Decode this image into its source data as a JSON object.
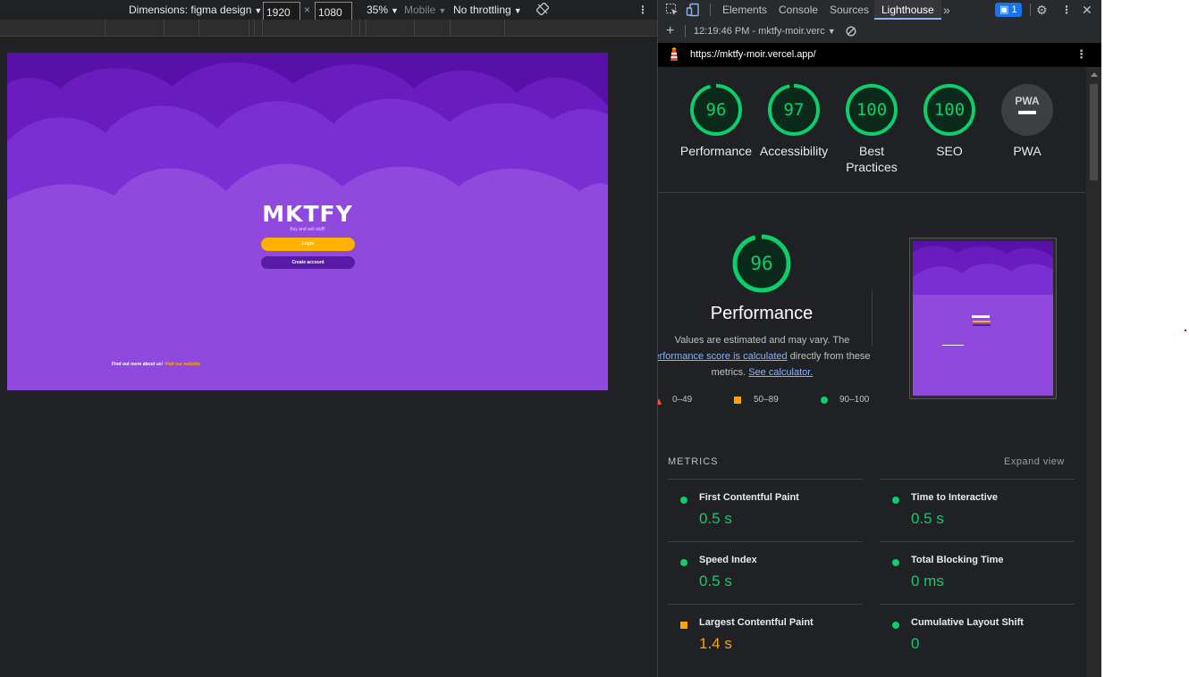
{
  "device_toolbar": {
    "dimensions_label": "Dimensions: figma design",
    "width": "1920",
    "height": "1080",
    "times": "×",
    "zoom": "35%",
    "device_type": "Mobile",
    "throttling": "No throttling"
  },
  "site": {
    "title": "MKTFY",
    "subtitle": "Buy and sell stuff!",
    "login_label": "Login",
    "create_label": "Create account",
    "footer_text": "Find out more about us!",
    "footer_link": "Visit our website"
  },
  "devtools": {
    "tabs": [
      "Elements",
      "Console",
      "Sources",
      "Lighthouse"
    ],
    "active_tab": "Lighthouse",
    "more": "»",
    "issues_count": "1",
    "report_time": "12:19:46 PM - mktfy-moir.verc",
    "url": "https://mktfy-moir.vercel.app/"
  },
  "scores": [
    {
      "value": "96",
      "label": "Performance",
      "fraction": 0.96,
      "color": "#0cce6b"
    },
    {
      "value": "97",
      "label": "Accessibility",
      "fraction": 0.97,
      "color": "#0cce6b"
    },
    {
      "value": "100",
      "label": "Best Practices",
      "fraction": 1.0,
      "color": "#0cce6b"
    },
    {
      "value": "100",
      "label": "SEO",
      "fraction": 1.0,
      "color": "#0cce6b"
    },
    {
      "value": "PWA",
      "label": "PWA",
      "fraction": 0,
      "color": "#9aa0a6"
    }
  ],
  "performance": {
    "score": "96",
    "fraction": 0.96,
    "title": "Performance",
    "note_prefix": "Values are estimated and may vary. The",
    "note_link": "erformance score is calculated",
    "note_mid": "directly from these",
    "note_end": "metrics.",
    "note_link2": "See calculator.",
    "legend": [
      "0–49",
      "50–89",
      "90–100"
    ]
  },
  "metrics": {
    "title": "METRICS",
    "expand": "Expand view",
    "items": [
      {
        "name": "First Contentful Paint",
        "value": "0.5 s",
        "status": "pass"
      },
      {
        "name": "Time to Interactive",
        "value": "0.5 s",
        "status": "pass"
      },
      {
        "name": "Speed Index",
        "value": "0.5 s",
        "status": "pass"
      },
      {
        "name": "Total Blocking Time",
        "value": "0 ms",
        "status": "pass"
      },
      {
        "name": "Largest Contentful Paint",
        "value": "1.4 s",
        "status": "average"
      },
      {
        "name": "Cumulative Layout Shift",
        "value": "0",
        "status": "pass"
      }
    ]
  },
  "colors": {
    "pass": "#0cce6b",
    "average": "#ffa400",
    "fail": "#ff4e42",
    "site_purple": "#9049dd",
    "site_yellow": "#ffb100"
  }
}
